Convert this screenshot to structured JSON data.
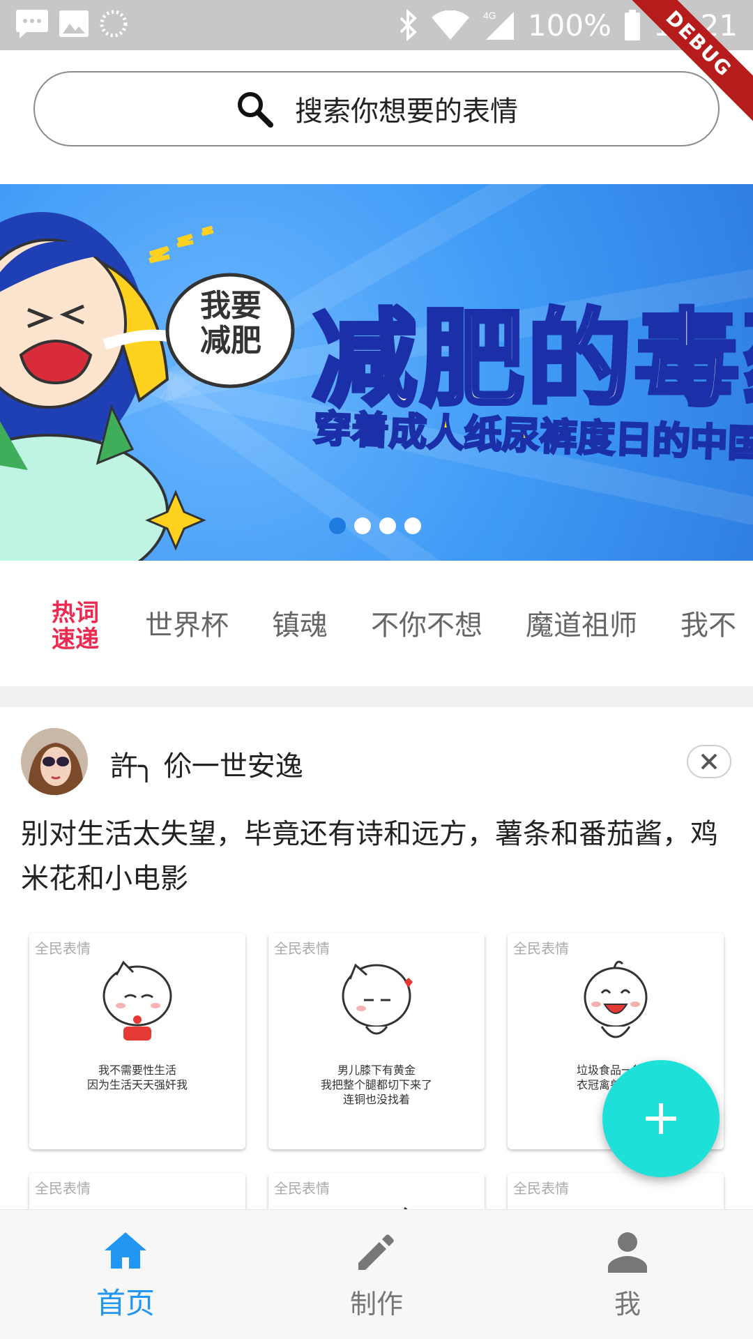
{
  "status_bar": {
    "battery": "100%",
    "time": "16:21",
    "network": "4G",
    "debug_label": "DEBUG"
  },
  "search": {
    "placeholder": "搜索你想要的表情"
  },
  "banner": {
    "title": "减肥的毒药",
    "subtitle": "穿着成人纸尿裤度日的中国女孩们",
    "bubble_text": "我要减肥",
    "active_dot": 0,
    "dot_count": 4
  },
  "hot_words": {
    "badge": "热词速递",
    "tags": [
      "世界杯",
      "镇魂",
      "不你不想",
      "魔道祖师",
      "我不"
    ]
  },
  "post": {
    "username": "許╮ 伱一世安逸",
    "text": "别对生活太失望，毕竟还有诗和远方，薯条和番茄酱，鸡米花和小电影",
    "stickers": [
      {
        "watermark": "全民表情",
        "caption": "我不需要性生活\n因为生活天天强奸我"
      },
      {
        "watermark": "全民表情",
        "caption": "男儿膝下有黄金\n我把整个腿都切下来了\n连铜也没找着"
      },
      {
        "watermark": "全民表情",
        "caption": "垃圾食品一般般\n衣冠禽兽看起来"
      },
      {
        "watermark": "全民表情",
        "caption": ""
      },
      {
        "watermark": "全民表情",
        "caption": ""
      },
      {
        "watermark": "全民表情",
        "caption": ""
      }
    ]
  },
  "fab": {
    "icon": "plus-icon"
  },
  "bottom_nav": [
    {
      "label": "首页",
      "icon": "home-icon",
      "active": true
    },
    {
      "label": "制作",
      "icon": "pencil-icon",
      "active": false
    },
    {
      "label": "我",
      "icon": "person-icon",
      "active": false
    }
  ],
  "colors": {
    "accent": "#2196f3",
    "fab": "#1de1d8",
    "hot": "#ee2a50",
    "banner": "#3f9af5"
  }
}
